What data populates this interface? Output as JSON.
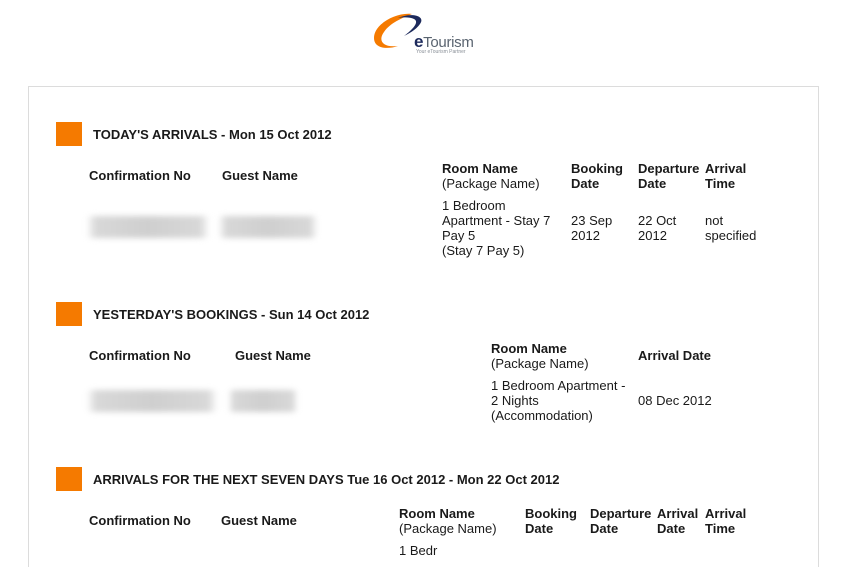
{
  "logo": {
    "brand_prefix": "e",
    "brand_rest": "Tourism",
    "tagline": "Your eTourism Partner",
    "icon": "swoosh-logo-icon",
    "colors": {
      "orange": "#f57a00",
      "navy": "#1d2a5c"
    }
  },
  "accent_color": "#f57a00",
  "sections": [
    {
      "title": "TODAY'S ARRIVALS - Mon 15 Oct 2012",
      "headers": {
        "confirmation": "Confirmation No",
        "guest": "Guest Name",
        "room": "Room Name",
        "room_sub": "(Package Name)",
        "booking_1": "Booking",
        "booking_2": "Date",
        "departure_1": "Departure",
        "departure_2": "Date",
        "arrival_time_1": "Arrival",
        "arrival_time_2": "Time"
      },
      "rows": [
        {
          "confirmation": "[redacted]",
          "guest": "[redacted]",
          "room_lines": [
            "1 Bedroom",
            "Apartment - Stay 7",
            "Pay 5",
            "(Stay 7 Pay 5)"
          ],
          "booking_lines": [
            "23 Sep",
            "2012"
          ],
          "departure_lines": [
            "22 Oct",
            "2012"
          ],
          "arrival_time_lines": [
            "not",
            "specified"
          ]
        }
      ]
    },
    {
      "title": "YESTERDAY'S BOOKINGS - Sun 14 Oct 2012",
      "headers": {
        "confirmation": "Confirmation No",
        "guest": "Guest Name",
        "room": "Room Name",
        "room_sub": "(Package Name)",
        "arrival_date": "Arrival Date"
      },
      "rows": [
        {
          "confirmation": "[redacted]",
          "guest": "[redacted]",
          "room_lines": [
            "1 Bedroom Apartment -",
            "2 Nights",
            "(Accommodation)"
          ],
          "arrival_date": "08 Dec 2012"
        }
      ]
    },
    {
      "title": "ARRIVALS FOR THE NEXT SEVEN DAYS Tue 16 Oct 2012 - Mon 22 Oct 2012",
      "headers": {
        "confirmation": "Confirmation No",
        "guest": "Guest Name",
        "room": "Room Name",
        "room_sub": "(Package Name)",
        "booking_1": "Booking",
        "booking_2": "Date",
        "departure_1": "Departure",
        "departure_2": "Date",
        "arrival_date_1": "Arrival",
        "arrival_date_2": "Date",
        "arrival_time_1": "Arrival",
        "arrival_time_2": "Time"
      },
      "rows": [
        {
          "room_lines": [
            "1 Bedr"
          ]
        }
      ]
    }
  ]
}
